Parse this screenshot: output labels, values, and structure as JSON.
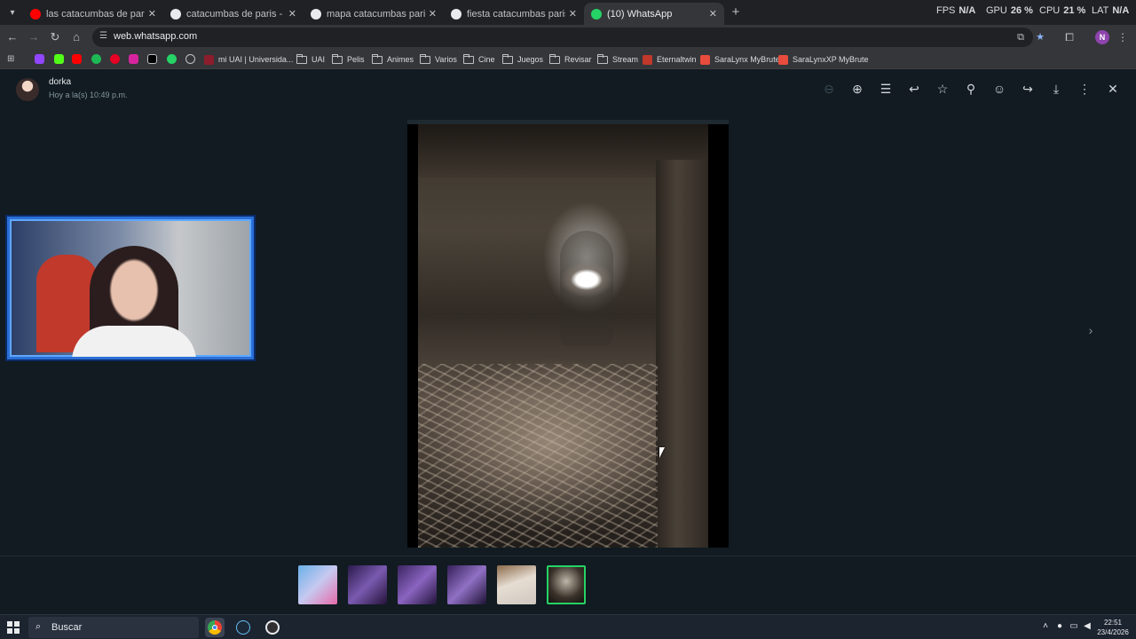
{
  "browser": {
    "tabs": [
      {
        "title": "las catacumbas de paris - YouTube",
        "icon": "youtube-icon",
        "color": "#ff0000",
        "active": false
      },
      {
        "title": "catacumbas de paris - Buscar con Google",
        "icon": "google-icon",
        "color": "#e8eaed",
        "active": false
      },
      {
        "title": "mapa catacumbas paris - Buscar con Google",
        "icon": "google-icon",
        "color": "#e8eaed",
        "active": false
      },
      {
        "title": "fiesta catacumbas paris - Buscar con Google",
        "icon": "google-icon",
        "color": "#e8eaed",
        "active": false
      },
      {
        "title": "(10) WhatsApp",
        "icon": "whatsapp-icon",
        "color": "#25d366",
        "active": true
      }
    ],
    "hud": {
      "fps_label": "FPS",
      "fps_value": "N/A",
      "gpu_label": "GPU",
      "gpu_value": "26 %",
      "cpu_label": "CPU",
      "cpu_value": "21 %",
      "lat_label": "LAT",
      "lat_value": "N/A"
    },
    "url": "web.whatsapp.com",
    "profile_initial": "N",
    "bookmarks": [
      {
        "label": "mi UAI | Universida...",
        "type": "site",
        "color": "#8b1d2c"
      },
      {
        "label": "UAI",
        "type": "folder"
      },
      {
        "label": "Pelis",
        "type": "folder"
      },
      {
        "label": "Animes",
        "type": "folder"
      },
      {
        "label": "Varios",
        "type": "folder"
      },
      {
        "label": "Cine",
        "type": "folder"
      },
      {
        "label": "Juegos",
        "type": "folder"
      },
      {
        "label": "Revisar",
        "type": "folder"
      },
      {
        "label": "Stream",
        "type": "folder"
      },
      {
        "label": "Eternaltwin",
        "type": "site",
        "color": "#c0392b"
      },
      {
        "label": "SaraLynx MyBrute",
        "type": "site",
        "color": "#e74c3c"
      },
      {
        "label": "SaraLynxXP MyBrute",
        "type": "site",
        "color": "#e74c3c"
      }
    ]
  },
  "viewer": {
    "sender_name": "dorka",
    "sender_time": "Hoy a la(s) 10:49 p.m.",
    "colors": {
      "background": "#111b21",
      "selected_thumb": "#25d366"
    }
  },
  "taskbar": {
    "search_placeholder": "Buscar",
    "time": "22:51",
    "date": "23/4/2026"
  }
}
